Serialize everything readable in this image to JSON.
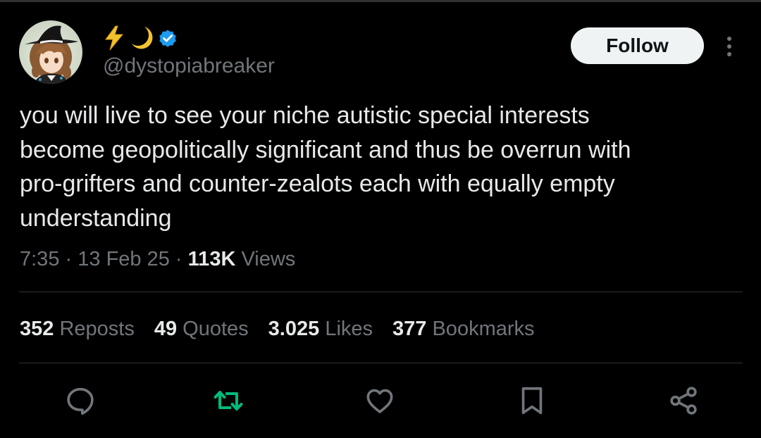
{
  "author": {
    "display_name_emoji": [
      "⚡",
      "🌙"
    ],
    "verified": true,
    "handle": "@dystopiabreaker"
  },
  "follow_button": {
    "label": "Follow"
  },
  "tweet": {
    "lines": [
      "you will live to see your niche autistic special interests",
      "become geopolitically significant and thus be overrun with",
      "pro-grifters and counter-zealots each with equally empty",
      "understanding"
    ],
    "time": "7:35",
    "separator": "·",
    "date": "13 Feb 25",
    "views_count": "113K",
    "views_label": "Views"
  },
  "stats": [
    {
      "count": "352",
      "label": "Reposts"
    },
    {
      "count": "49",
      "label": "Quotes"
    },
    {
      "count": "3.025",
      "label": "Likes"
    },
    {
      "count": "377",
      "label": "Bookmarks"
    }
  ],
  "actions": [
    "reply-icon",
    "repost-icon",
    "like-icon",
    "bookmark-icon",
    "share-icon"
  ],
  "colors": {
    "background": "#000000",
    "text": "#e7e9ea",
    "secondary_text": "#71767b",
    "verified": "#1d9bf0",
    "repost_active": "#00ba7c",
    "divider": "#2f3336"
  }
}
